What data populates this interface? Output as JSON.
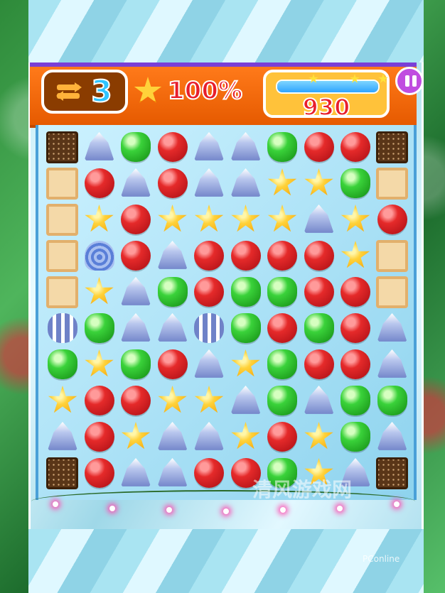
{
  "hud": {
    "moves_icon": "swap-arrows-icon",
    "moves": "3",
    "star_icon": "star-icon",
    "percent": "100%",
    "score": "930",
    "progress_fraction": 1.0,
    "pause_icon": "pause-icon"
  },
  "board": {
    "rows": [
      [
        "chocolate",
        "blue",
        "green",
        "red",
        "blue",
        "blue",
        "green",
        "red",
        "red",
        "chocolate"
      ],
      [
        "tile",
        "red",
        "blue",
        "red",
        "blue",
        "blue",
        "star",
        "star",
        "green",
        "tile"
      ],
      [
        "tile",
        "star",
        "red",
        "star",
        "star",
        "star",
        "star",
        "blue",
        "star",
        "red"
      ],
      [
        "tile",
        "swirl",
        "red",
        "blue",
        "red",
        "red",
        "red",
        "red",
        "star",
        "tile"
      ],
      [
        "tile",
        "star",
        "blue",
        "green",
        "red",
        "green",
        "green",
        "red",
        "red",
        "tile"
      ],
      [
        "striped",
        "green",
        "blue",
        "blue",
        "striped",
        "green",
        "red",
        "green",
        "red",
        "blue"
      ],
      [
        "green",
        "star",
        "green",
        "red",
        "blue",
        "star",
        "green",
        "red",
        "red",
        "blue"
      ],
      [
        "star",
        "red",
        "red",
        "star",
        "star",
        "blue",
        "green",
        "blue",
        "green",
        "green"
      ],
      [
        "blue",
        "red",
        "star",
        "blue",
        "blue",
        "star",
        "red",
        "star",
        "green",
        "blue"
      ],
      [
        "chocolate",
        "red",
        "blue",
        "blue",
        "red",
        "red",
        "green",
        "star",
        "blue",
        "chocolate"
      ]
    ]
  },
  "watermark": {
    "site_text": "清风游戏网",
    "brand_text": "PConline"
  },
  "colors": {
    "hud_orange": "#ff7a1a",
    "score_red": "#e81e2c",
    "moves_blue": "#2fc4ff",
    "pause_purple": "#c04de0"
  }
}
